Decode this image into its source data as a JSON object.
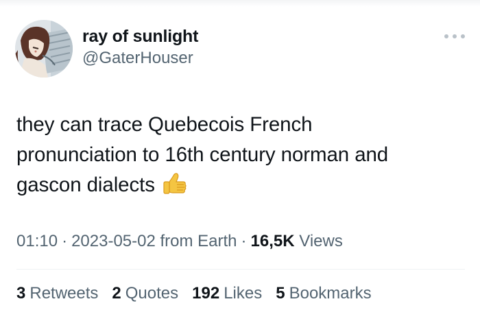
{
  "author": {
    "display_name": "ray of sunlight",
    "handle": "@GaterHouser",
    "avatar_icon": "anime-character-avatar"
  },
  "more_menu_icon": "more-dots-icon",
  "tweet": {
    "text_lines": [
      "they can trace Quebecois French",
      "pronunciation to 16th century norman and",
      "gascon dialects"
    ],
    "emoji_icon": "thumbs-up-icon"
  },
  "meta": {
    "time": "01:10",
    "separator": "·",
    "date": "2023-05-02",
    "source": "from Earth",
    "views_count": "16,5K",
    "views_label": "Views"
  },
  "stats": {
    "retweets_count": "3",
    "retweets_label": "Retweets",
    "quotes_count": "2",
    "quotes_label": "Quotes",
    "likes_count": "192",
    "likes_label": "Likes",
    "bookmarks_count": "5",
    "bookmarks_label": "Bookmarks"
  },
  "colors": {
    "text_primary": "#0f1419",
    "text_secondary": "#536471",
    "divider": "#eff3f4",
    "more_dots": "#b9c1c8"
  }
}
